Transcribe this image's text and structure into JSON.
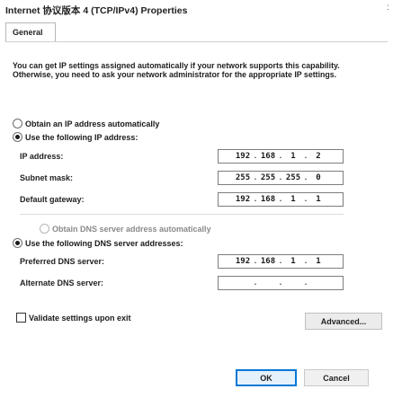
{
  "window": {
    "title": "Internet 协议版本 4 (TCP/IPv4) Properties",
    "edge_mark": ":"
  },
  "tabs": [
    {
      "label": "General"
    }
  ],
  "intro": "You can get IP settings assigned automatically if your network supports this capability. Otherwise, you need to ask your network administrator for the appropriate IP settings.",
  "ip_section": {
    "auto_label": "Obtain an IP address automatically",
    "manual_label": "Use the following IP address:",
    "selected": "manual",
    "fields": [
      {
        "label": "IP address:",
        "value": [
          "192",
          "168",
          "1",
          "2"
        ]
      },
      {
        "label": "Subnet mask:",
        "value": [
          "255",
          "255",
          "255",
          "0"
        ]
      },
      {
        "label": "Default gateway:",
        "value": [
          "192",
          "168",
          "1",
          "1"
        ]
      }
    ]
  },
  "dns_section": {
    "auto_label": "Obtain DNS server address automatically",
    "manual_label": "Use the following DNS server addresses:",
    "selected": "manual",
    "fields": [
      {
        "label": "Preferred DNS server:",
        "value": [
          "192",
          "168",
          "1",
          "1"
        ]
      },
      {
        "label": "Alternate DNS server:",
        "value": [
          "",
          "",
          "",
          ""
        ]
      }
    ]
  },
  "validate_label": "Validate settings upon exit",
  "validate_checked": false,
  "buttons": {
    "advanced": "Advanced...",
    "ok": "OK",
    "cancel": "Cancel"
  },
  "colors": {
    "ok_border": "#0078d7",
    "ok_bg": "#e5f1fb"
  }
}
